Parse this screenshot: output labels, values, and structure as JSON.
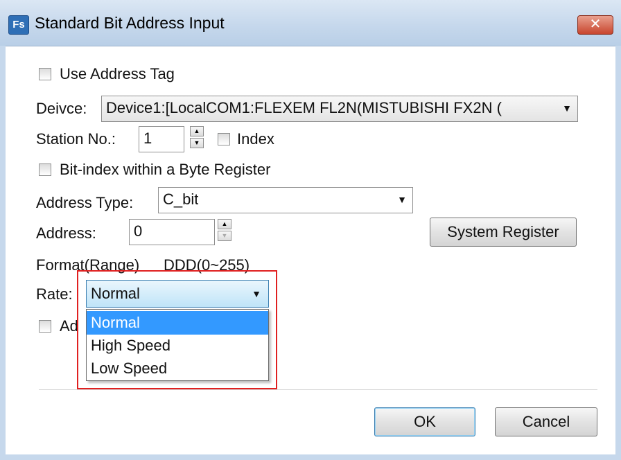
{
  "window": {
    "app_icon_text": "Fs",
    "title": "Standard Bit Address Input",
    "close_label": "x"
  },
  "form": {
    "use_address_tag_label": "Use Address Tag",
    "device_label": "Deivce:",
    "device_value": "Device1:[LocalCOM1:FLEXEM FL2N(MISTUBISHI FX2N (",
    "station_label": "Station No.:",
    "station_value": "1",
    "index_label": "Index",
    "bit_index_label": "Bit-index within a Byte Register",
    "address_type_label": "Address Type:",
    "address_type_value": "C_bit",
    "address_label": "Address:",
    "address_value": "0",
    "system_register_label": "System Register",
    "format_label": "Format(Range)",
    "format_value": "DDD(0~255)",
    "rate_label": "Rate:",
    "rate_value": "Normal",
    "partial_checkbox_label": "Ad"
  },
  "rate_dropdown": {
    "options": [
      "Normal",
      "High Speed",
      "Low Speed"
    ],
    "selected": "Normal"
  },
  "buttons": {
    "ok": "OK",
    "cancel": "Cancel"
  },
  "colors": {
    "selection": "#3399ff",
    "highlight_border": "#e02020",
    "titlebar": "#c6d8ec"
  }
}
